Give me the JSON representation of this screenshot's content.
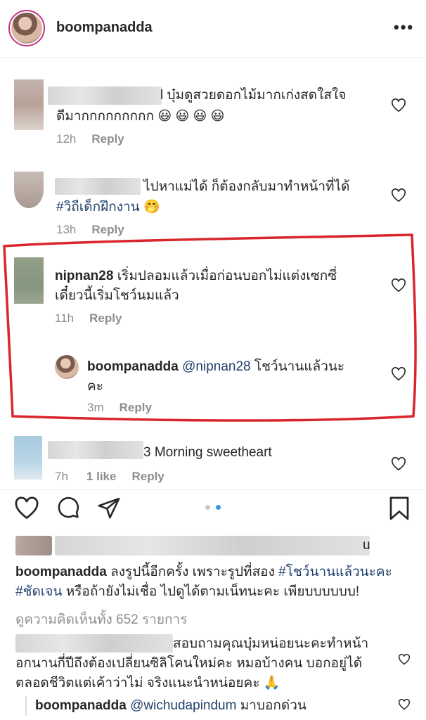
{
  "header": {
    "username": "boompanadda",
    "more_icon": "more-horizontal-icon"
  },
  "comments": [
    {
      "text": "l บุ๋มดูสวยดอกไม้มากเก่งสดใสใจ",
      "text2": "ดีมากกกกกกกกก",
      "emoji": "😃 😃 😃 😃",
      "time": "12h",
      "reply": "Reply"
    },
    {
      "text": "ไปหาแม่ได้ ก็ต้องกลับมาทำหน้าที่ได้",
      "tag": "#วิถีเด็กฝึกงาน",
      "emoji": "🤭",
      "time": "13h",
      "reply": "Reply"
    },
    {
      "username": "nipnan28",
      "text": "เริ่มปลอมแล้วเมื่อก่อนบอกไม่แต่งเซกซี่",
      "text2": "เดี๋ยวนี้เริ่มโชว์นมแล้ว",
      "time": "11h",
      "reply": "Reply"
    },
    {
      "username": "boompanadda",
      "mention": "@nipnan28",
      "text": "โชว์นานแล้วนะ",
      "text2": "คะ",
      "time": "3m",
      "reply": "Reply"
    },
    {
      "text": "3 Morning sweetheart",
      "time": "7h",
      "likes": "1 like",
      "reply": "Reply"
    }
  ],
  "actions": {
    "like_icon": "heart-icon",
    "comment_icon": "comment-icon",
    "share_icon": "send-icon",
    "save_icon": "bookmark-icon"
  },
  "caption": {
    "username": "boompanadda",
    "text": "ลงรูปนี้อีกครั้ง เพราะรูปที่สอง",
    "tag1": "#โชว์นานแล้วนะคะ",
    "tag2": "#ชัดเจน",
    "text2": "หรือถ้ายังไม่เชื่อ ไปดูได้ตามเน็ทนะคะ เพียบบบบบบ!",
    "blurred_tail": "u"
  },
  "view_all": "ดูความคิดเห็นทั้ง 652 รายการ",
  "preview_comments": [
    {
      "text": "สอบถามคุณบุ๋มหน่อยนะคะทำหน้า",
      "text2": "อกนานกี่ปีถึงต้องเปลี่ยนซิลิโคนใหม่คะ หมอบ้างคน บอกอยู่ได้",
      "text3": "ตลอดชีวิตแต่เค้าว่าไม่ จริงแนะนำหน่อยคะ",
      "emoji": "🙏"
    },
    {
      "username": "boompanadda",
      "mention": "@wichudapindum",
      "text": "มาบอกด่วน"
    }
  ],
  "colors": {
    "highlight": "#d9262c",
    "link": "#1e3f6a",
    "meta": "#8e8e8e",
    "dot_active": "#3897f0"
  }
}
